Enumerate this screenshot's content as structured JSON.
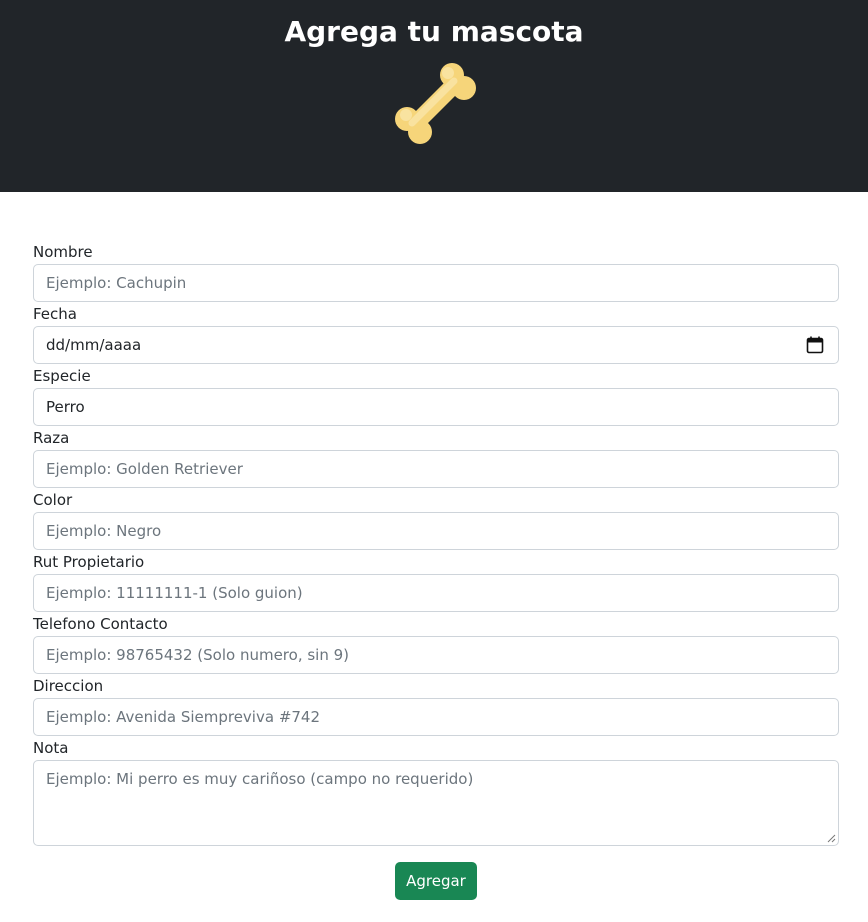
{
  "header": {
    "title": "Agrega tu mascota",
    "icon": "bone-icon",
    "background": "#212529",
    "icon_color": "#f6d57a"
  },
  "form": {
    "nombre": {
      "label": "Nombre",
      "placeholder": "Ejemplo: Cachupin"
    },
    "fecha": {
      "label": "Fecha",
      "value": "dd/mm/aaaa"
    },
    "especie": {
      "label": "Especie",
      "value": "Perro"
    },
    "raza": {
      "label": "Raza",
      "placeholder": "Ejemplo: Golden Retriever"
    },
    "color": {
      "label": "Color",
      "placeholder": "Ejemplo: Negro"
    },
    "rut": {
      "label": "Rut Propietario",
      "placeholder": "Ejemplo: 11111111-1 (Solo guion)"
    },
    "telefono": {
      "label": "Telefono Contacto",
      "placeholder": "Ejemplo: 98765432 (Solo numero, sin 9)"
    },
    "direccion": {
      "label": "Direccion",
      "placeholder": "Ejemplo: Avenida Siempreviva #742"
    },
    "nota": {
      "label": "Nota",
      "placeholder": "Ejemplo: Mi perro es muy cariñoso (campo no requerido)"
    }
  },
  "submit": {
    "label": "Agregar",
    "color": "#198754"
  }
}
